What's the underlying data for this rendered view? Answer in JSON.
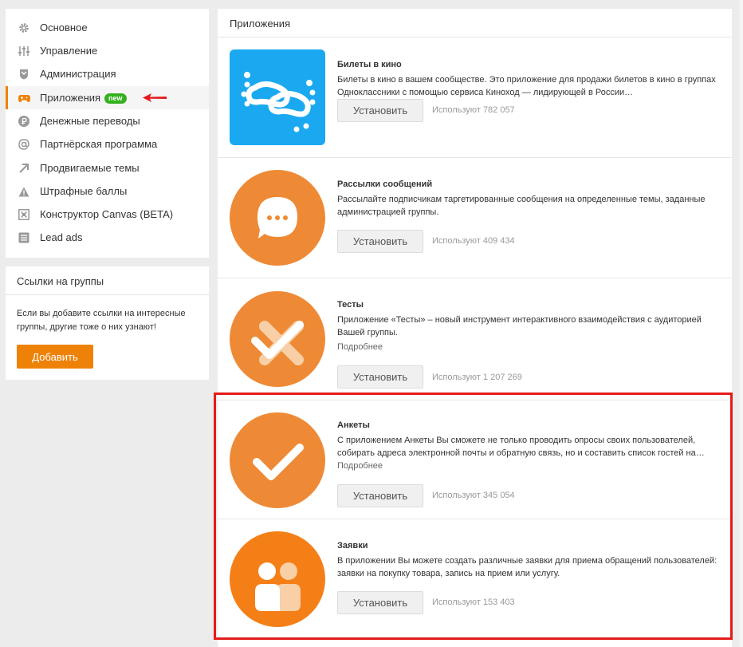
{
  "sidebar": {
    "items": [
      {
        "label": "Основное",
        "icon": "gear-icon"
      },
      {
        "label": "Управление",
        "icon": "sliders-icon"
      },
      {
        "label": "Администрация",
        "icon": "shield-icon"
      },
      {
        "label": "Приложения",
        "icon": "gamepad-icon",
        "badge": "new"
      },
      {
        "label": "Денежные переводы",
        "icon": "ruble-icon"
      },
      {
        "label": "Партнёрская программа",
        "icon": "at-icon"
      },
      {
        "label": "Продвигаемые темы",
        "icon": "arrow-up-right-icon"
      },
      {
        "label": "Штрафные баллы",
        "icon": "warning-icon"
      },
      {
        "label": "Конструктор Canvas (BETA)",
        "icon": "canvas-icon"
      },
      {
        "label": "Lead ads",
        "icon": "list-icon"
      }
    ]
  },
  "links_box": {
    "title": "Ссылки на группы",
    "text": "Если вы добавите ссылки на интересные группы, другие тоже о них узнают!",
    "add_label": "Добавить"
  },
  "main": {
    "title": "Приложения",
    "install_label": "Установить",
    "apps": [
      {
        "name": "Билеты в кино",
        "description": "Билеты в кино в вашем сообществе. Это приложение для продажи билетов в кино в группах Одноклассники с помощью сервиса Киноход — лидирующей в России…",
        "more": "",
        "uses": "Используют 782 057",
        "icon": "footprints-icon"
      },
      {
        "name": "Рассылки сообщений",
        "description": "Рассылайте подписчикам таргетированные сообщения на определенные темы, заданные администрацией группы.",
        "more": "",
        "uses": "Используют 409 434",
        "icon": "chat-bubble-icon"
      },
      {
        "name": "Тесты",
        "description": "Приложение «Тесты» – новый инструмент интерактивного взаимодействия с аудиторией Вашей группы.",
        "more": "Подробнее",
        "uses": "Используют 1 207 269",
        "icon": "check-cross-icon"
      },
      {
        "name": "Анкеты",
        "description": "С приложением Анкеты Вы сможете не только проводить опросы своих пользователей, собирать адреса электронной почты и обратную связь, но и составить список гостей на…",
        "more": "Подробнее",
        "uses": "Используют 345 054",
        "icon": "checkmark-icon"
      },
      {
        "name": "Заявки",
        "description": "В приложении Вы можете создать различные заявки для приема обращений пользователей: заявки на покупку товара, запись на прием или услугу.",
        "more": "",
        "uses": "Используют 153 403",
        "icon": "users-icon"
      }
    ]
  },
  "colors": {
    "accent": "#ee8208",
    "badge": "#35b01f",
    "highlight": "#e41b1b",
    "blue_app": "#1aa9f0"
  }
}
